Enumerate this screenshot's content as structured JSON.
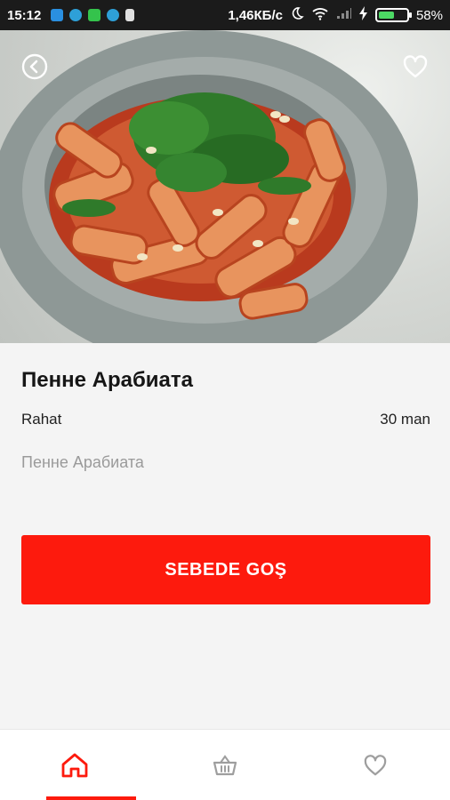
{
  "status_bar": {
    "time": "15:12",
    "network_speed": "1,46КБ/с",
    "battery": "58%",
    "battery_level": 0.58
  },
  "hero": {
    "back_icon": "back-circle-icon",
    "favorite_icon": "heart-outline-icon"
  },
  "product": {
    "name": "Пенне Арабиата",
    "restaurant": "Rahat",
    "price": "30 man",
    "description": "Пенне Арабиата"
  },
  "actions": {
    "add_to_cart_label": "SEBEDE GOŞ"
  },
  "bottom_nav": {
    "items": [
      {
        "icon": "home-icon",
        "active": true
      },
      {
        "icon": "basket-icon",
        "active": false
      },
      {
        "icon": "heart-icon",
        "active": false
      }
    ]
  },
  "colors": {
    "accent": "#fd1a0d",
    "inactive_icon": "#9e9e9e"
  }
}
